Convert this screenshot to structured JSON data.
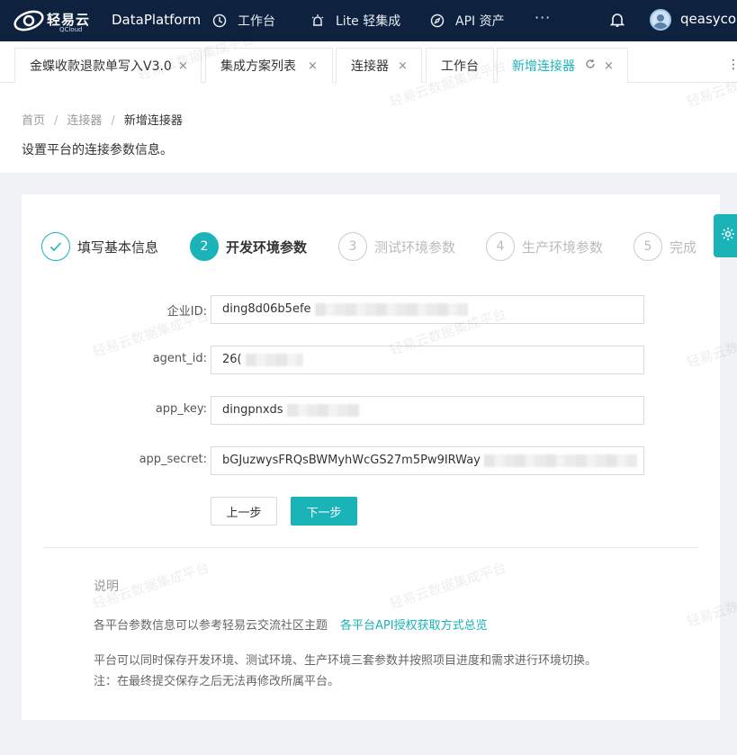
{
  "topnav": {
    "logo_cn": "轻易云",
    "logo_en": "QCloud",
    "product": "DataPlatform",
    "items": [
      {
        "label": "工作台",
        "icon": "clock-icon"
      },
      {
        "label": "Lite 轻集成",
        "icon": "alarm-icon"
      },
      {
        "label": "API 资产",
        "icon": "compass-icon"
      }
    ],
    "more": "···",
    "username": "qeasycop"
  },
  "tabs": [
    {
      "label": "金蝶收款退款单写入V3.0",
      "close": "×"
    },
    {
      "label": "集成方案列表",
      "close": "×"
    },
    {
      "label": "连接器",
      "close": "×"
    },
    {
      "label": "工作台",
      "close": ""
    },
    {
      "label": "新增连接器",
      "close": "×",
      "refresh": "C",
      "active": true
    }
  ],
  "tab_menu": "⋮",
  "breadcrumb": {
    "home": "首页",
    "level2": "连接器",
    "current": "新增连接器",
    "sep": "/"
  },
  "page_desc": "设置平台的连接参数信息。",
  "steps": [
    {
      "num": "✓",
      "label": "填写基本信息",
      "state": "done"
    },
    {
      "num": "2",
      "label": "开发环境参数",
      "state": "active"
    },
    {
      "num": "3",
      "label": "测试环境参数",
      "state": "pending"
    },
    {
      "num": "4",
      "label": "生产环境参数",
      "state": "pending"
    },
    {
      "num": "5",
      "label": "完成",
      "state": "pending"
    }
  ],
  "form": {
    "corp_id": {
      "label": "企业ID:",
      "value": "ding8d06b5efe"
    },
    "agent_id": {
      "label": "agent_id:",
      "value": "26("
    },
    "app_key": {
      "label": "app_key:",
      "value": "dingpnxds"
    },
    "app_secret": {
      "label": "app_secret:",
      "value": "bGJuzwysFRQsBWMyhWcGS27m5Pw9IRWay"
    }
  },
  "buttons": {
    "prev": "上一步",
    "next": "下一步"
  },
  "notes": {
    "title": "说明",
    "line1": "各平台参数信息可以参考轻易云交流社区主题",
    "link": "各平台API授权获取方式总览",
    "line2": "平台可以同时保存开发环境、测试环境、生产环境三套参数并按照项目进度和需求进行环境切换。",
    "line3": "注：在最终提交保存之后无法再修改所属平台。"
  },
  "watermark": "轻易云数据集成平台",
  "colors": {
    "accent": "#1ab3b8",
    "nav_bg": "#0e2240"
  }
}
